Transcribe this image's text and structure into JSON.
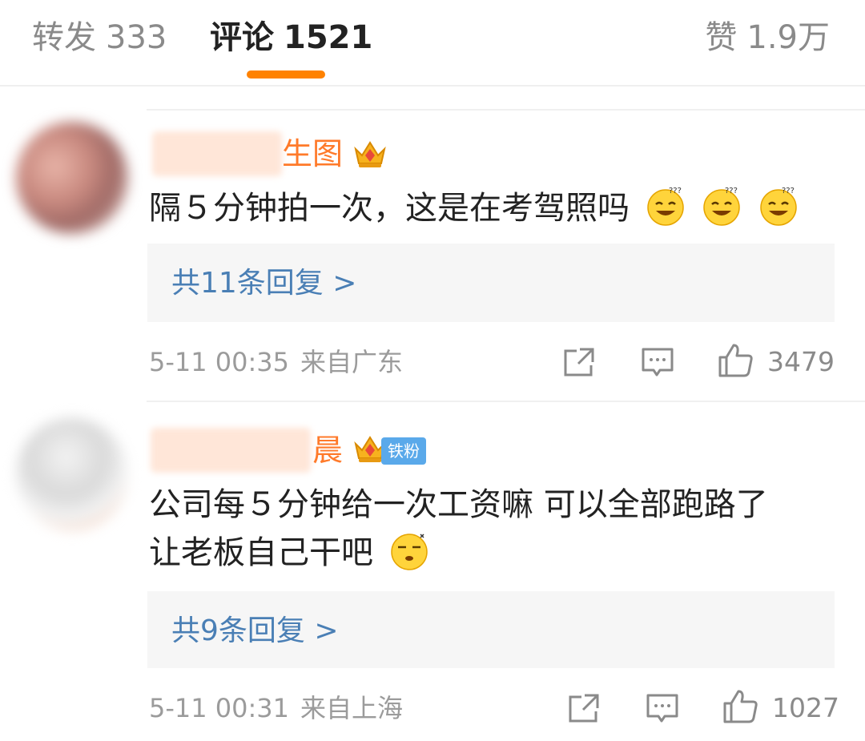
{
  "tabs": {
    "repost_label": "转发",
    "repost_count": "333",
    "comment_label": "评论",
    "comment_count": "1521",
    "like_label": "赞",
    "like_count": "1.9万"
  },
  "comments": [
    {
      "name_suffix": "生图",
      "text": "隔５分钟拍一次，这是在考驾照吗",
      "emojis": [
        "dizzy-grin-emoji",
        "dizzy-grin-emoji",
        "dizzy-grin-emoji"
      ],
      "replies": "共11条回复 >",
      "time": "5-11 00:35",
      "location": "来自广东",
      "likes": "3479"
    },
    {
      "name_suffix": "晨",
      "fan_badge": "铁粉",
      "text_line1": "公司每５分钟给一次工资嘛 可以全部跑路了",
      "text_line2": "让老板自己干吧",
      "emojis": [
        "sleepy-emoji"
      ],
      "replies": "共9条回复 >",
      "time": "5-11 00:31",
      "location": "来自上海",
      "likes": "1027"
    }
  ],
  "colors": {
    "accent": "#ff8200",
    "username": "#ff7a2a",
    "reply_link": "#4a7fb5",
    "muted": "#9b9b9b"
  }
}
